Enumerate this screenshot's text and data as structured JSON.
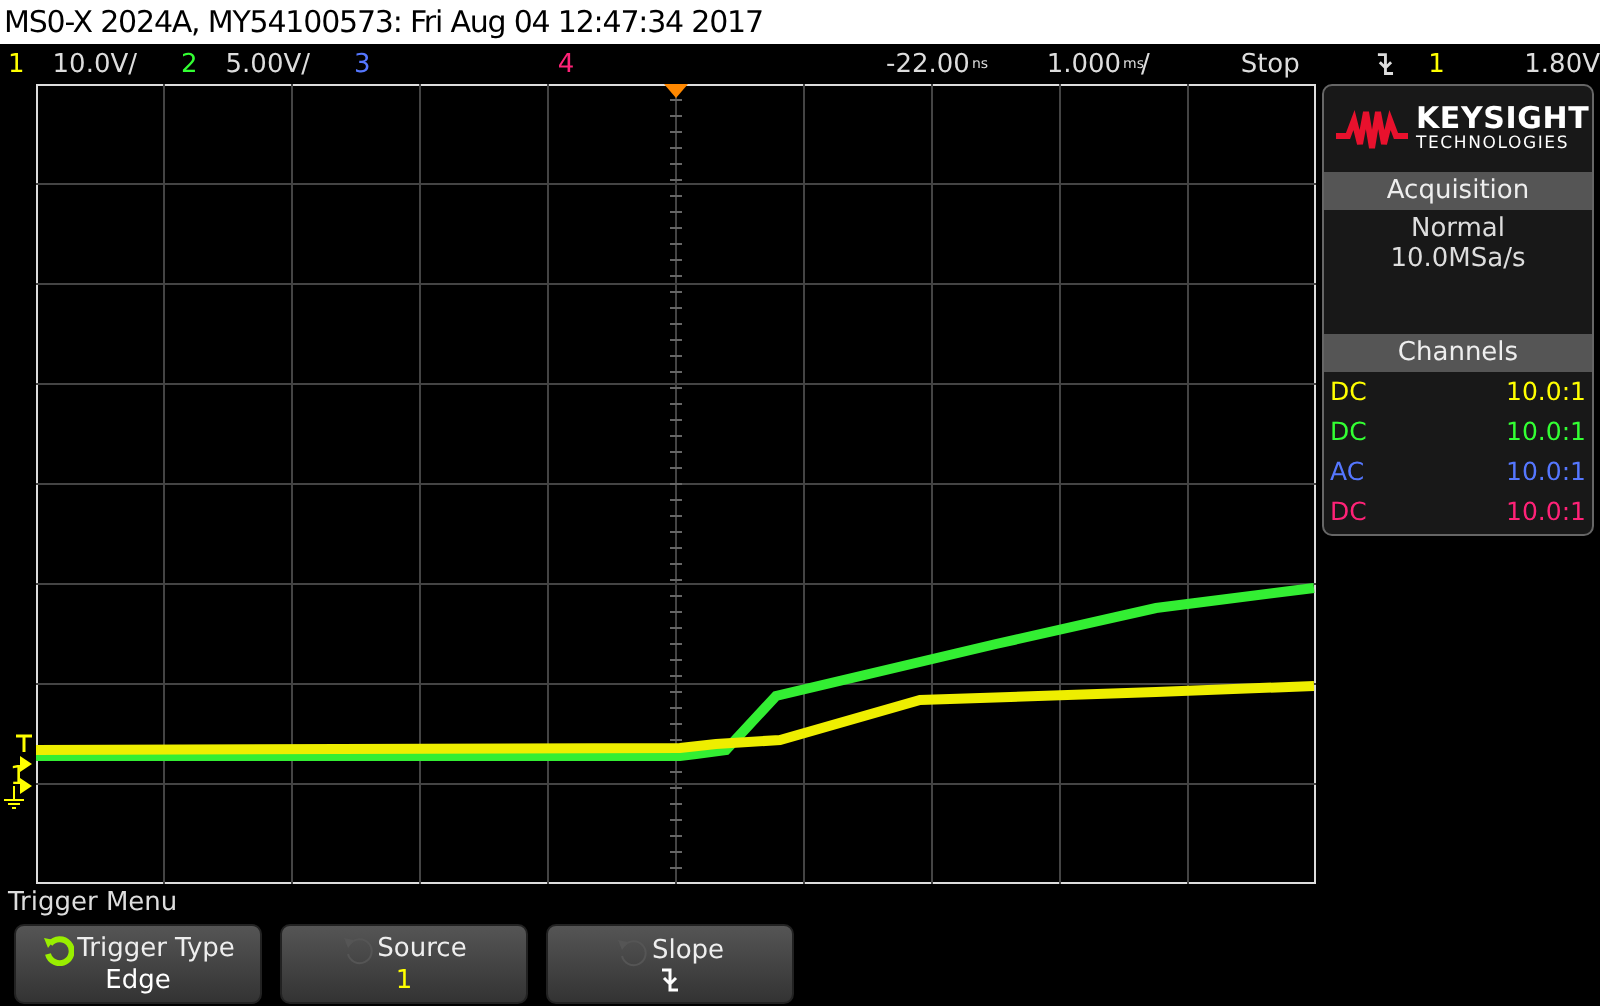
{
  "title_bar": {
    "title": "MS0-X 2024A, MY54100573: Fri Aug 04 12:47:34 2017"
  },
  "status_bar": {
    "channels": [
      {
        "number": "1",
        "scale": "10.0V/",
        "color": "#ffff00"
      },
      {
        "number": "2",
        "scale": "5.00V/",
        "color": "#33ff33"
      },
      {
        "number": "3",
        "color": "#5577ff"
      },
      {
        "number": "4",
        "color": "#ff2277"
      }
    ],
    "delay": {
      "value": "-22.00",
      "unit": "ns"
    },
    "timebase": {
      "value": "1.000",
      "unit": "ms",
      "suffix": "/"
    },
    "run_state": "Stop",
    "trigger": {
      "source": "1",
      "level": "1.80V"
    }
  },
  "display": {
    "channel_marker": "1"
  },
  "side_panel": {
    "logo": {
      "name": "KEYSIGHT",
      "subtitle": "TECHNOLOGIES"
    },
    "acquisition": {
      "title": "Acquisition",
      "mode": "Normal",
      "rate": "10.0MSa/s"
    },
    "channels": {
      "title": "Channels",
      "rows": [
        {
          "coupling": "DC",
          "probe": "10.0:1",
          "color": "#ffff00"
        },
        {
          "coupling": "DC",
          "probe": "10.0:1",
          "color": "#33ff33"
        },
        {
          "coupling": "AC",
          "probe": "10.0:1",
          "color": "#5577ff"
        },
        {
          "coupling": "DC",
          "probe": "10.0:1",
          "color": "#ff2277"
        }
      ]
    }
  },
  "menu": {
    "title": "Trigger Menu",
    "softkeys": [
      {
        "label": "Trigger Type",
        "value": "Edge",
        "kind": "text",
        "active": true
      },
      {
        "label": "Source",
        "value": "1",
        "kind": "text",
        "active": false
      },
      {
        "label": "Slope",
        "kind": "slope",
        "active": false
      }
    ]
  }
}
